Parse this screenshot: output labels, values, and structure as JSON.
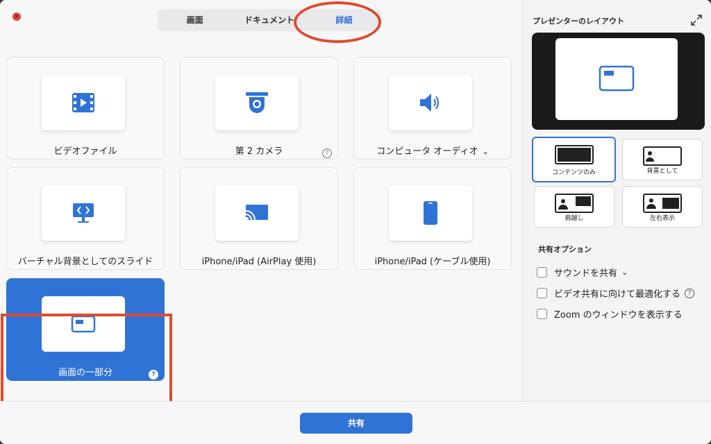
{
  "tabs": [
    {
      "label": "画面"
    },
    {
      "label": "ドキュメント"
    },
    {
      "label": "詳細"
    }
  ],
  "cards": [
    {
      "label": "ビデオファイル",
      "icon": "video-file-icon"
    },
    {
      "label": "第 2 カメラ",
      "icon": "camera-icon",
      "help": "?"
    },
    {
      "label": "コンピュータ オーディオ",
      "icon": "speaker-icon",
      "chevron": "⌄"
    },
    {
      "label": "バーチャル背景としてのスライド",
      "icon": "slides-monitor-icon"
    },
    {
      "label": "iPhone/iPad (AirPlay 使用)",
      "icon": "airplay-icon"
    },
    {
      "label": "iPhone/iPad (ケーブル使用)",
      "icon": "phone-icon"
    },
    {
      "label": "画面の一部分",
      "icon": "screen-portion-icon",
      "help": "?"
    }
  ],
  "right_panel": {
    "title": "プレゼンターのレイアウト",
    "layouts": [
      {
        "label": "コンテンツのみ"
      },
      {
        "label": "背景として"
      },
      {
        "label": "肩越し"
      },
      {
        "label": "左右表示"
      }
    ],
    "options_title": "共有オプション",
    "options": [
      {
        "label": "サウンドを共有",
        "chevron": "⌄"
      },
      {
        "label": "ビデオ共有に向けて最適化する",
        "help": "?"
      },
      {
        "label": "Zoom のウィンドウを表示する"
      }
    ]
  },
  "footer": {
    "share_label": "共有"
  },
  "colors": {
    "accent": "#2f73d6",
    "highlight": "#e04a2f",
    "close": "#e2453c"
  }
}
